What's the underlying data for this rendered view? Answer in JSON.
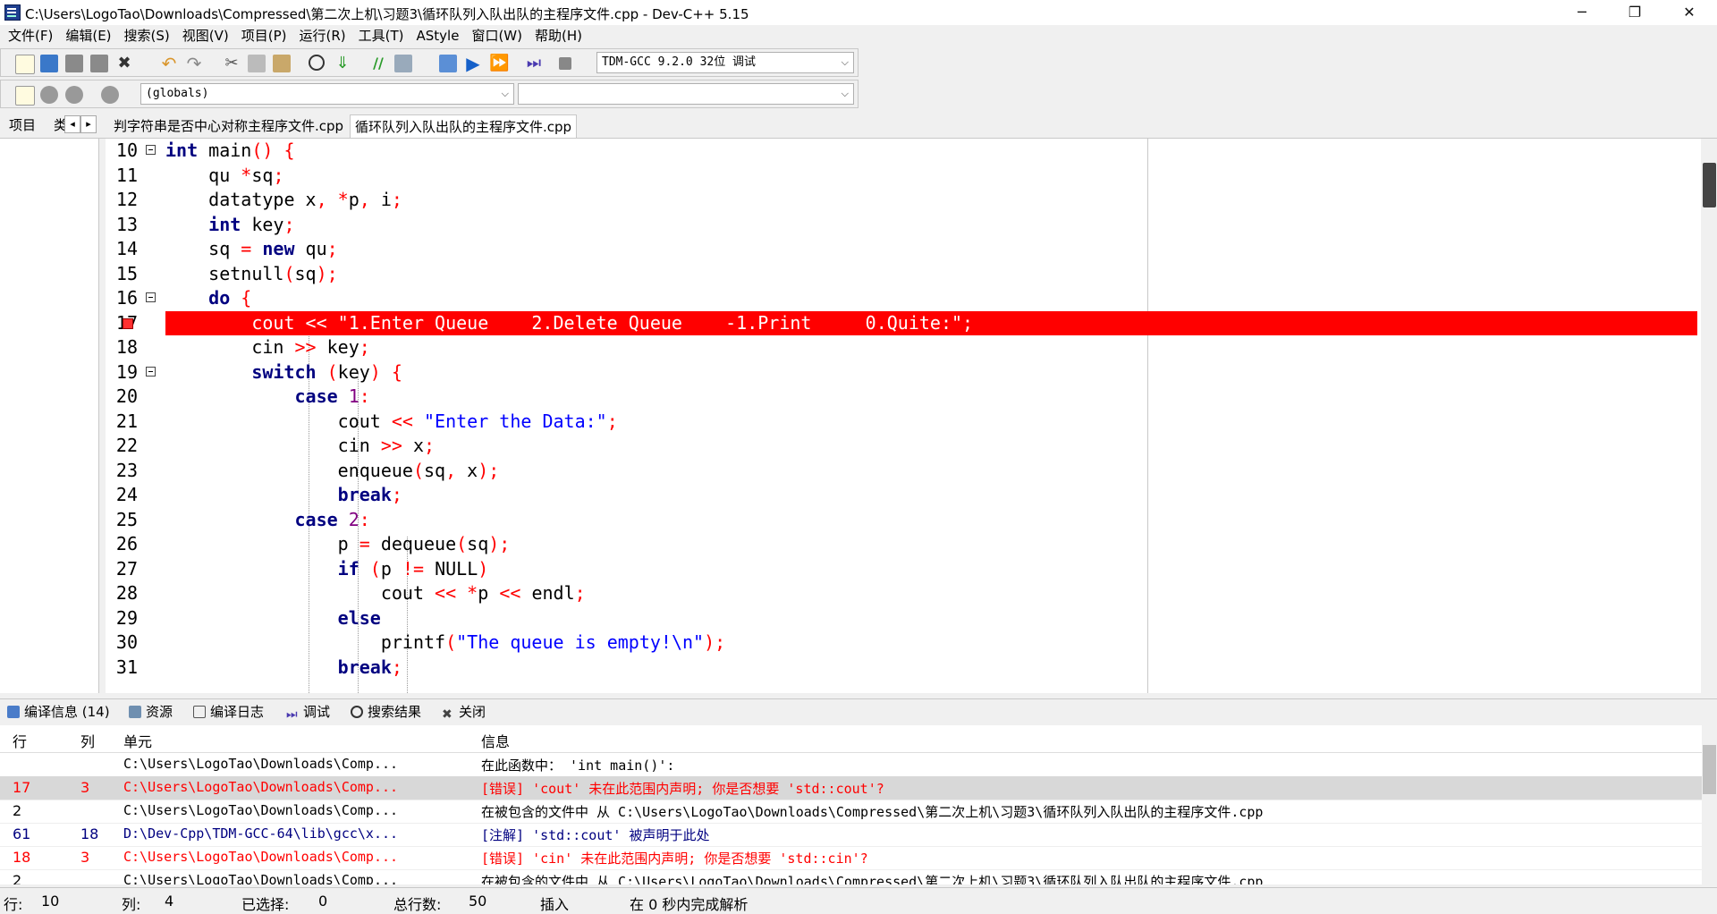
{
  "window": {
    "title": "C:\\Users\\LogoTao\\Downloads\\Compressed\\第二次上机\\习题3\\循环队列入队出队的主程序文件.cpp - Dev-C++ 5.15",
    "minimize": "─",
    "maximize": "❐",
    "close": "✕"
  },
  "menu": [
    "文件(F)",
    "编辑(E)",
    "搜索(S)",
    "视图(V)",
    "项目(P)",
    "运行(R)",
    "工具(T)",
    "AStyle",
    "窗口(W)",
    "帮助(H)"
  ],
  "toolbar": {
    "compiler": "TDM-GCC 9.2.0 32位 调试",
    "scope": "(globals)",
    "member": ""
  },
  "left_tabs": {
    "project": "项目",
    "classes": "类",
    "prev": "◂",
    "next": "▸"
  },
  "file_tabs": [
    "判字符串是否中心对称主程序文件.cpp",
    "循环队列入队出队的主程序文件.cpp"
  ],
  "editor": {
    "lines": [
      {
        "n": "10",
        "fold": true
      },
      {
        "n": "11"
      },
      {
        "n": "12"
      },
      {
        "n": "13"
      },
      {
        "n": "14"
      },
      {
        "n": "15"
      },
      {
        "n": "16",
        "fold": true
      },
      {
        "n": "17",
        "error": true
      },
      {
        "n": "18"
      },
      {
        "n": "19",
        "fold": true
      },
      {
        "n": "20"
      },
      {
        "n": "21"
      },
      {
        "n": "22"
      },
      {
        "n": "23"
      },
      {
        "n": "24"
      },
      {
        "n": "25"
      },
      {
        "n": "26"
      },
      {
        "n": "27"
      },
      {
        "n": "28"
      },
      {
        "n": "29"
      },
      {
        "n": "30"
      },
      {
        "n": "31"
      }
    ],
    "code": {
      "l10_a": "int",
      "l10_b": " main",
      "l10_c": "()",
      "l10_d": " {",
      "l11_a": "    qu ",
      "l11_b": "*",
      "l11_c": "sq",
      "l11_d": ";",
      "l12_a": "    datatype x",
      "l12_b": ",",
      "l12_c": " ",
      "l12_d": "*",
      "l12_e": "p",
      "l12_f": ",",
      "l12_g": " i",
      "l12_h": ";",
      "l13_a": "    ",
      "l13_b": "int",
      "l13_c": " key",
      "l13_d": ";",
      "l14_a": "    sq ",
      "l14_b": "=",
      "l14_c": " ",
      "l14_d": "new",
      "l14_e": " qu",
      "l14_f": ";",
      "l15_a": "    setnull",
      "l15_b": "(",
      "l15_c": "sq",
      "l15_d": ");",
      "l16_a": "    ",
      "l16_b": "do",
      "l16_c": " {",
      "l17": "        cout << \"1.Enter Queue    2.Delete Queue    -1.Print     0.Quite:\";",
      "l18_a": "        cin ",
      "l18_b": ">>",
      "l18_c": " key",
      "l18_d": ";",
      "l19_a": "        ",
      "l19_b": "switch",
      "l19_c": " ",
      "l19_d": "(",
      "l19_e": "key",
      "l19_f": ")",
      "l19_g": " {",
      "l20_a": "            ",
      "l20_b": "case",
      "l20_c": " ",
      "l20_d": "1",
      "l20_e": ":",
      "l21_a": "                cout ",
      "l21_b": "<<",
      "l21_c": " ",
      "l21_d": "\"Enter the Data:\"",
      "l21_e": ";",
      "l22_a": "                cin ",
      "l22_b": ">>",
      "l22_c": " x",
      "l22_d": ";",
      "l23_a": "                enqueue",
      "l23_b": "(",
      "l23_c": "sq",
      "l23_d": ",",
      "l23_e": " x",
      "l23_f": ");",
      "l24_a": "                ",
      "l24_b": "break",
      "l24_c": ";",
      "l25_a": "            ",
      "l25_b": "case",
      "l25_c": " ",
      "l25_d": "2",
      "l25_e": ":",
      "l26_a": "                p ",
      "l26_b": "=",
      "l26_c": " dequeue",
      "l26_d": "(",
      "l26_e": "sq",
      "l26_f": ");",
      "l27_a": "                ",
      "l27_b": "if",
      "l27_c": " ",
      "l27_d": "(",
      "l27_e": "p ",
      "l27_f": "!=",
      "l27_g": " NULL",
      "l27_h": ")",
      "l28_a": "                    cout ",
      "l28_b": "<<",
      "l28_c": " ",
      "l28_d": "*",
      "l28_e": "p ",
      "l28_f": "<<",
      "l28_g": " endl",
      "l28_h": ";",
      "l29_a": "                ",
      "l29_b": "else",
      "l30_a": "                    printf",
      "l30_b": "(",
      "l30_c": "\"The queue is empty!\\n\"",
      "l30_d": ");",
      "l31_a": "                ",
      "l31_b": "break",
      "l31_c": ";"
    }
  },
  "bottom_tabs": [
    "编译信息 (14)",
    "资源",
    "编译日志",
    "调试",
    "搜索结果",
    "关闭"
  ],
  "messages": {
    "headers": {
      "row": "行",
      "col": "列",
      "unit": "单元",
      "info": "信息"
    },
    "rows": [
      {
        "row": "",
        "col": "",
        "unit": "C:\\Users\\LogoTao\\Downloads\\Comp...",
        "info": "在此函数中： 'int main()':"
      },
      {
        "row": "17",
        "col": "3",
        "unit": "C:\\Users\\LogoTao\\Downloads\\Comp...",
        "info": "[错误] 'cout' 未在此范围内声明; 你是否想要 'std::cout'?"
      },
      {
        "row": "2",
        "col": "",
        "unit": "C:\\Users\\LogoTao\\Downloads\\Comp...",
        "info": "在被包含的文件中 从 C:\\Users\\LogoTao\\Downloads\\Compressed\\第二次上机\\习题3\\循环队列入队出队的主程序文件.cpp"
      },
      {
        "row": "61",
        "col": "18",
        "unit": "D:\\Dev-Cpp\\TDM-GCC-64\\lib\\gcc\\x...",
        "info": "[注解] 'std::cout' 被声明于此处"
      },
      {
        "row": "18",
        "col": "3",
        "unit": "C:\\Users\\LogoTao\\Downloads\\Comp...",
        "info": "[错误] 'cin' 未在此范围内声明; 你是否想要 'std::cin'?"
      },
      {
        "row": "2",
        "col": "",
        "unit": "C:\\Users\\LogoTao\\Downloads\\Comp...",
        "info": "在被包含的文件中 从 C:\\Users\\LogoTao\\Downloads\\Compressed\\第二次上机\\习题3\\循环队列入队出队的主程序文件.cpp"
      }
    ]
  },
  "status": {
    "row_label": "行:",
    "row": "10",
    "col_label": "列:",
    "col": "4",
    "sel_label": "已选择:",
    "sel": "0",
    "total_label": "总行数:",
    "total": "50",
    "mode": "插入",
    "parse": "在 0 秒内完成解析"
  }
}
